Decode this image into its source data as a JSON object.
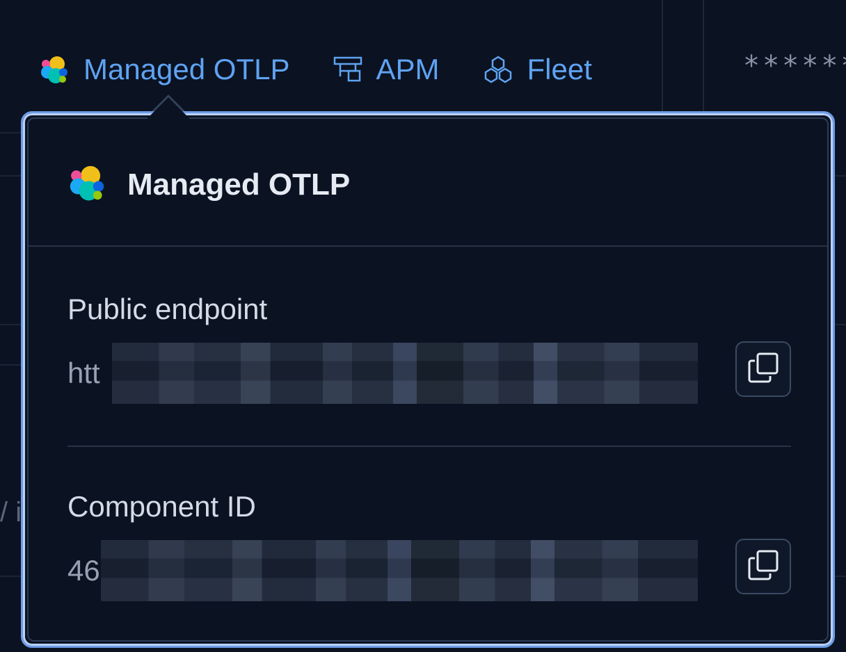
{
  "nav": {
    "items": [
      {
        "label": "Managed OTLP",
        "icon": "elastic-logo-icon"
      },
      {
        "label": "APM",
        "icon": "apm-icon"
      },
      {
        "label": "Fleet",
        "icon": "fleet-icon"
      }
    ],
    "masked_value": "*******"
  },
  "background": {
    "partial_text": "/ i"
  },
  "popover": {
    "title": "Managed OTLP",
    "icon": "elastic-logo-icon",
    "sections": [
      {
        "label": "Public endpoint",
        "value_prefix": "htt",
        "copy_icon": "copy-icon"
      },
      {
        "label": "Component ID",
        "value_prefix": "46",
        "copy_icon": "copy-icon"
      }
    ]
  },
  "colors": {
    "link": "#5fa3f2",
    "popover_border": "#6e9de8",
    "background": "#0b1221"
  }
}
